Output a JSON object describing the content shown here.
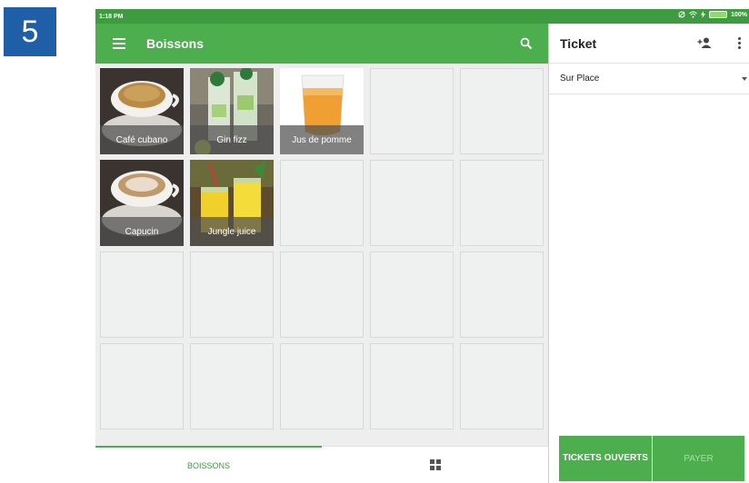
{
  "step_number": "5",
  "status_bar": {
    "time": "1:18 PM",
    "battery_text": "100%"
  },
  "app_bar": {
    "title": "Boissons"
  },
  "products": [
    {
      "name": "Café cubano"
    },
    {
      "name": "Gin fizz"
    },
    {
      "name": "Jus de pomme"
    },
    {
      "name": "Capucin"
    },
    {
      "name": "Jungle juice"
    }
  ],
  "bottom_tabs": {
    "active_tab": "BOISSONS"
  },
  "ticket": {
    "title": "Ticket",
    "dining_option": "Sur Place",
    "open_tickets_label": "TICKETS OUVERTS",
    "pay_label": "PAYER"
  },
  "colors": {
    "primary": "#4cae4c",
    "status_bar": "#3e9b3f",
    "step_badge": "#1f5fa8"
  }
}
